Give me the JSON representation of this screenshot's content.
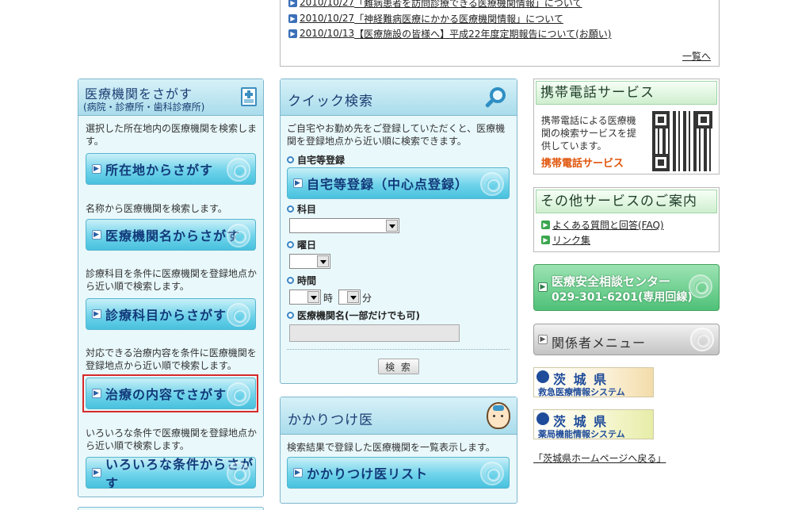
{
  "news": {
    "items": [
      {
        "date": "2010/10/27",
        "title": "「難病患者を訪問診療できる医療機関情報」について"
      },
      {
        "date": "2010/10/27",
        "title": "「神経難病医療にかかる医療機関情報」について"
      },
      {
        "date": "2010/10/13",
        "title": "【医療施設の皆様へ】平成22年度定期報告について(お願い)"
      }
    ],
    "more": "一覧へ"
  },
  "left_panel": {
    "title": "医療機関をさがす",
    "subtitle": "(病院・診療所・歯科診療所)",
    "sections": [
      {
        "desc": "選択した所在地内の医療機関を検索します。",
        "button": "所在地からさがす"
      },
      {
        "desc": "名称から医療機関を検索します。",
        "button": "医療機関名からさがす"
      },
      {
        "desc": "診療科目を条件に医療機関を登録地点から近い順で検索します。",
        "button": "診療科目からさがす"
      },
      {
        "desc": "対応できる治療内容を条件に医療機関を登録地点から近い順で検索します。",
        "button": "治療の内容でさがす"
      },
      {
        "desc": "いろいろな条件で医療機関を登録地点から近い順で検索します。",
        "button": "いろいろな条件からさがす"
      }
    ]
  },
  "quick_search": {
    "title": "クイック検索",
    "desc": "ご自宅やお勤め先をご登録していただくと、医療機関を登録地点から近い順に検索できます。",
    "home_label": "自宅等登録",
    "home_button": "自宅等登録（中心点登録）",
    "dept_label": "科目",
    "day_label": "曜日",
    "time_label": "時間",
    "hour_unit": "時",
    "minute_unit": "分",
    "name_label": "医療機関名(一部だけでも可)",
    "search_button": "検 索"
  },
  "kakaritsuke": {
    "title": "かかりつけ医",
    "desc": "検索結果で登録した医療機関を一覧表示します。",
    "button": "かかりつけ医リスト"
  },
  "mobile": {
    "title": "携帯電話サービス",
    "desc": "携帯電話による医療機関の検索サービスを提供しています。",
    "link": "携帯電話サービス"
  },
  "other": {
    "title": "その他サービスのご案内",
    "links": [
      "よくある質問と回答(FAQ)",
      "リンク集"
    ]
  },
  "safety_center": {
    "line1": "医療安全相談センター",
    "line2": "029-301-6201(専用回線)"
  },
  "staff_menu": "関係者メニュー",
  "banner_emergency": {
    "pref": "茨 城 県",
    "name": "救急医療情報システム"
  },
  "banner_pharmacy": {
    "pref": "茨 城 県",
    "name": "薬局機能情報システム"
  },
  "back_link": "「茨城県ホームページへ戻る」",
  "colors": {
    "accent": "#48c1de",
    "highlight": "#d62a2a",
    "green": "#4ec178",
    "orange": "#e0560c"
  }
}
